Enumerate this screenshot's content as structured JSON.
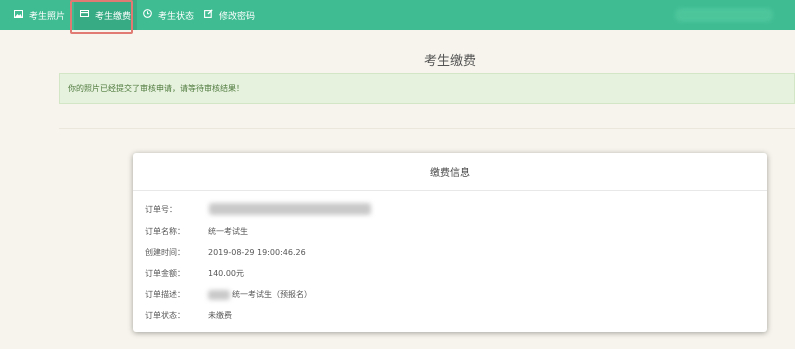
{
  "nav": {
    "items": [
      {
        "label": "考生照片",
        "icon": "image-icon"
      },
      {
        "label": "考生缴费",
        "icon": "card-icon"
      },
      {
        "label": "考生状态",
        "icon": "clock-icon"
      },
      {
        "label": "修改密码",
        "icon": "edit-icon"
      }
    ],
    "active_index": 1
  },
  "page": {
    "title": "考生缴费"
  },
  "alert": {
    "message": "你的照片已经提交了审核申请，请等待审核结果！"
  },
  "card": {
    "title": "缴费信息",
    "rows": [
      {
        "label": "订单号：",
        "value": ""
      },
      {
        "label": "订单名称：",
        "value": "统一考试生"
      },
      {
        "label": "创建时间：",
        "value": "2019-08-29 19:00:46.26"
      },
      {
        "label": "订单金额：",
        "value": "140.00元"
      },
      {
        "label": "订单描述：",
        "value": "统一考试生（预报名）"
      },
      {
        "label": "订单状态：",
        "value": "未缴费"
      }
    ]
  },
  "colors": {
    "navbar": "#3fbc92",
    "alert_bg": "#e6f2de",
    "alert_text": "#4f7a3d",
    "highlight": "#e07a73"
  }
}
